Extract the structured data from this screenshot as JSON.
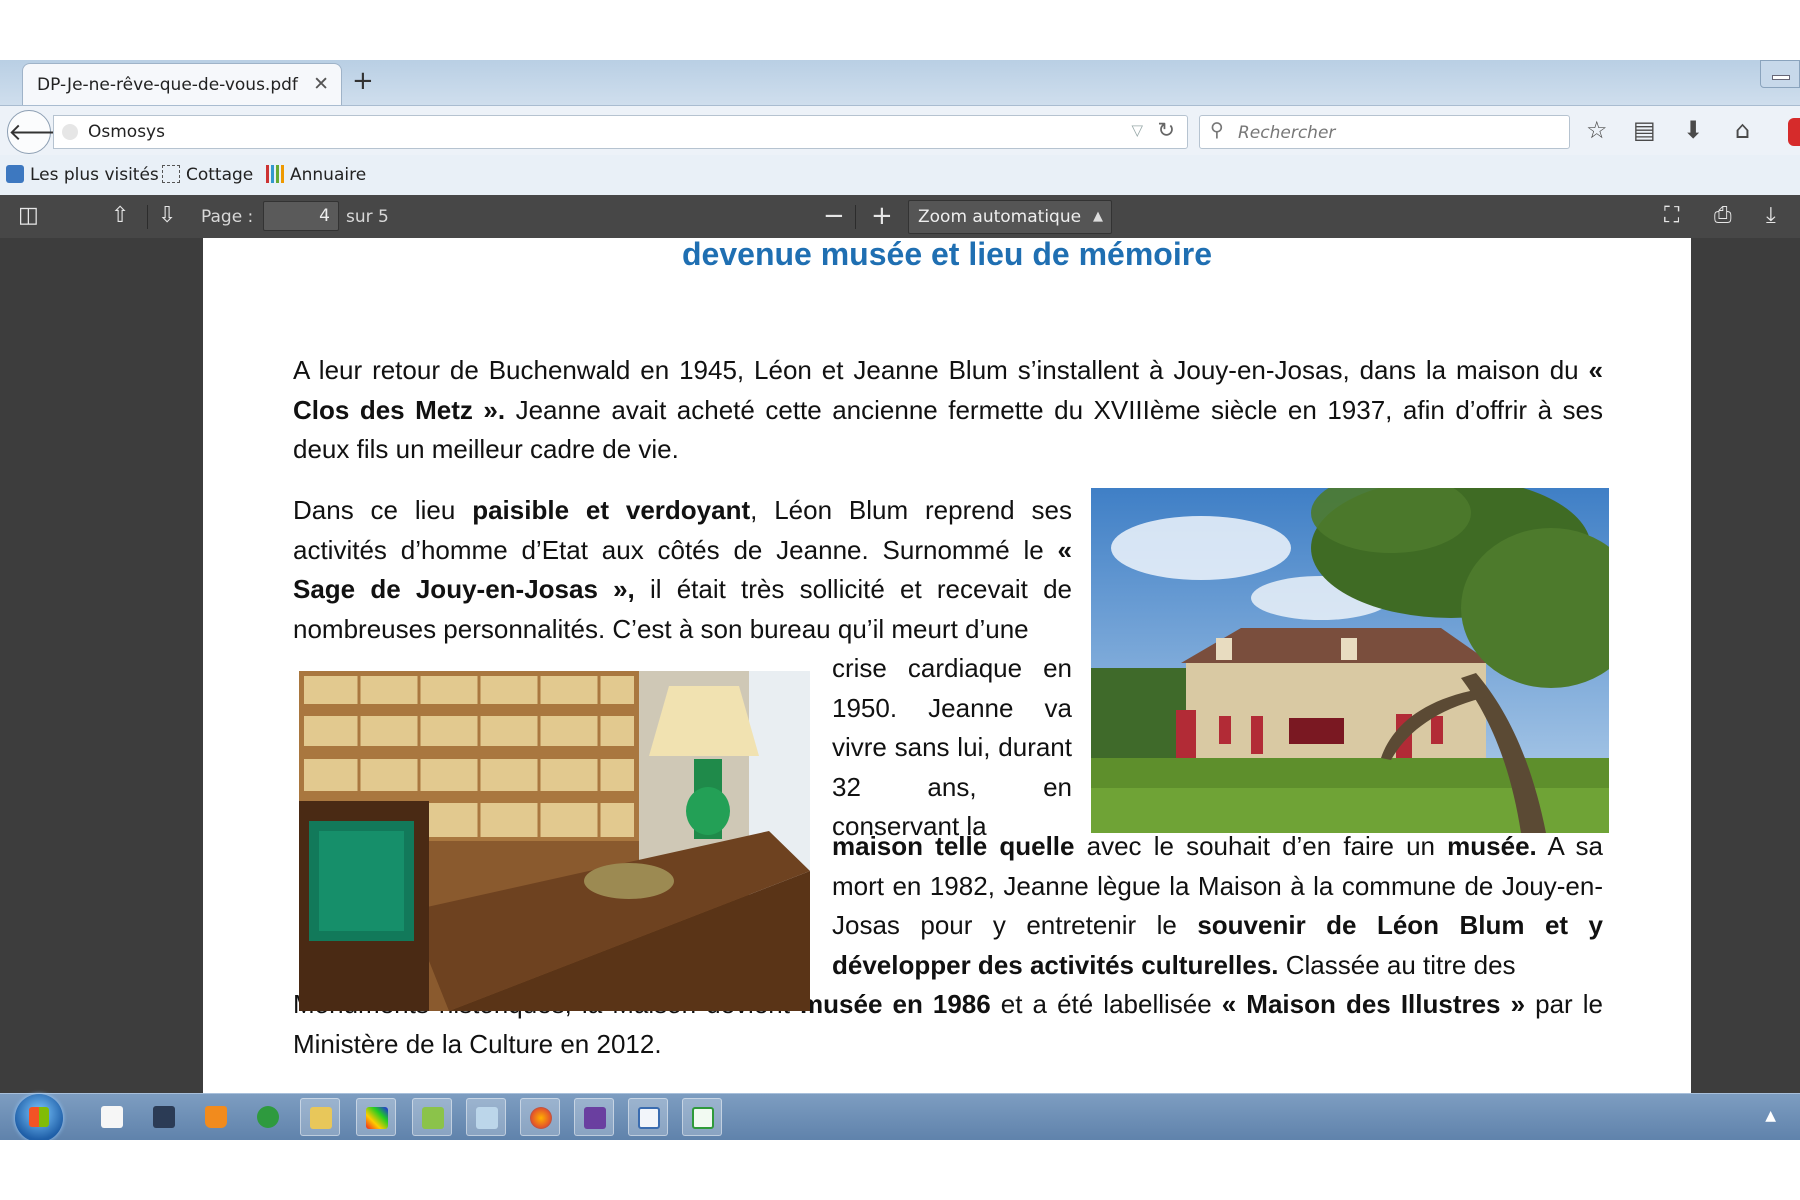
{
  "browser": {
    "tab": {
      "title": "DP-Je-ne-rêve-que-de-vous.pdf",
      "close": "✕"
    },
    "new_tab": "+",
    "url": "Osmosys",
    "search_placeholder": "Rechercher",
    "bookmarks": [
      "Les plus visités",
      "Cottage",
      "Annuaire"
    ]
  },
  "pdf_toolbar": {
    "page_label": "Page :",
    "page_number": "4",
    "page_total": "sur 5",
    "zoom": "Zoom automatique",
    "zoom_out": "−",
    "zoom_in": "+"
  },
  "document": {
    "title": "devenue musée et lieu de mémoire",
    "para1": {
      "t1": "A leur retour de Buchenwald en 1945, Léon et Jeanne Blum s’installent à Jouy-en-Josas, dans la maison du ",
      "b1": "« Clos des Metz ».",
      "t2": " Jeanne avait acheté cette ancienne fermette du XVIIIème siècle en 1937, afin d’offrir à ses deux fils un meilleur cadre de vie."
    },
    "para2": {
      "t1": "Dans ce lieu ",
      "b1": "paisible et verdoyant",
      "t2": ", Léon Blum reprend ses activités d’homme d’Etat aux côtés de Jeanne. Surnommé le ",
      "b2": "« Sage de Jouy-en-Josas »,",
      "t3": " il était très sollicité et recevait de nombreuses personnalités. C’est à son bureau qu’il meurt d’une"
    },
    "para3": {
      "t1": "crise cardiaque en 1950. Jeanne va vivre sans lui, durant 32 ans, en conservant la"
    },
    "para4": {
      "b1": "maison telle quelle",
      "t1": " avec le souhait d’en faire un ",
      "b2": "musée.",
      "t2": " A sa mort en 1982, Jeanne lègue la Maison à la commune de Jouy-en-Josas pour y entretenir le ",
      "b3": "souvenir de Léon Blum et y développer des activités culturelles.",
      "t3": " Classée au titre des"
    },
    "para5": {
      "t1": "Monuments historiques, la Maison devient ",
      "b1": "musée en 1986",
      "t2": " et a été labellisée ",
      "b2": "« Maison des Illustres »",
      "t3": " par le Ministère de la Culture en 2012."
    }
  }
}
